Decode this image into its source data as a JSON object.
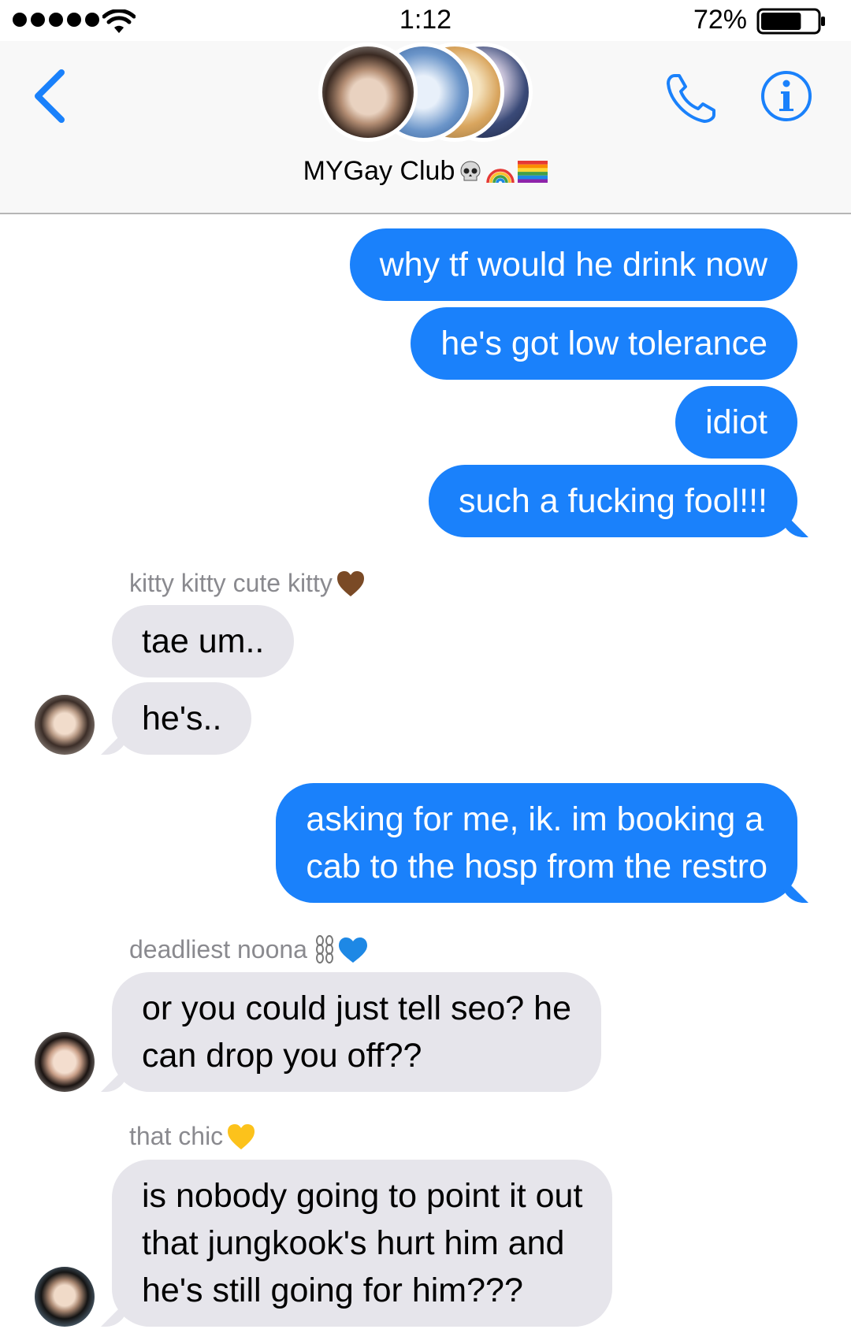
{
  "status_bar": {
    "time": "1:12",
    "battery": "72%",
    "battery_level": 0.72
  },
  "header": {
    "group_name": "MYGay Club",
    "group_emoji": [
      "skull-emoji",
      "rainbow-emoji",
      "rainbow-flag-emoji"
    ]
  },
  "messages": [
    {
      "from": "me",
      "text": "why tf would he drink now"
    },
    {
      "from": "me",
      "text": "he's got low tolerance"
    },
    {
      "from": "me",
      "text": "idiot"
    },
    {
      "from": "me",
      "text": "such a fucking fool!!!"
    },
    {
      "from": "them",
      "sender": "kitty kitty cute kitty",
      "sender_emoji": "brown-heart-emoji",
      "text": "tae um.."
    },
    {
      "from": "them",
      "text": "he's.."
    },
    {
      "from": "me",
      "lines": [
        "asking for me, ik. im booking a",
        "cab to the hosp from the restro"
      ]
    },
    {
      "from": "them",
      "sender": "deadliest noona",
      "sender_emoji": "chains-blue-heart-emoji",
      "lines": [
        "or you could just tell seo? he",
        "can drop you off??"
      ]
    },
    {
      "from": "them",
      "sender": "that chic",
      "sender_emoji": "yellow-heart-emoji",
      "lines": [
        "is nobody going to point it out",
        "that jungkook's hurt him and",
        "he's still going for him???"
      ]
    }
  ],
  "colors": {
    "accent": "#1a81fb",
    "outgoing_bubble": "#1a81fb",
    "incoming_bubble": "#e6e5eb",
    "sender_label": "#8a8a8f"
  }
}
